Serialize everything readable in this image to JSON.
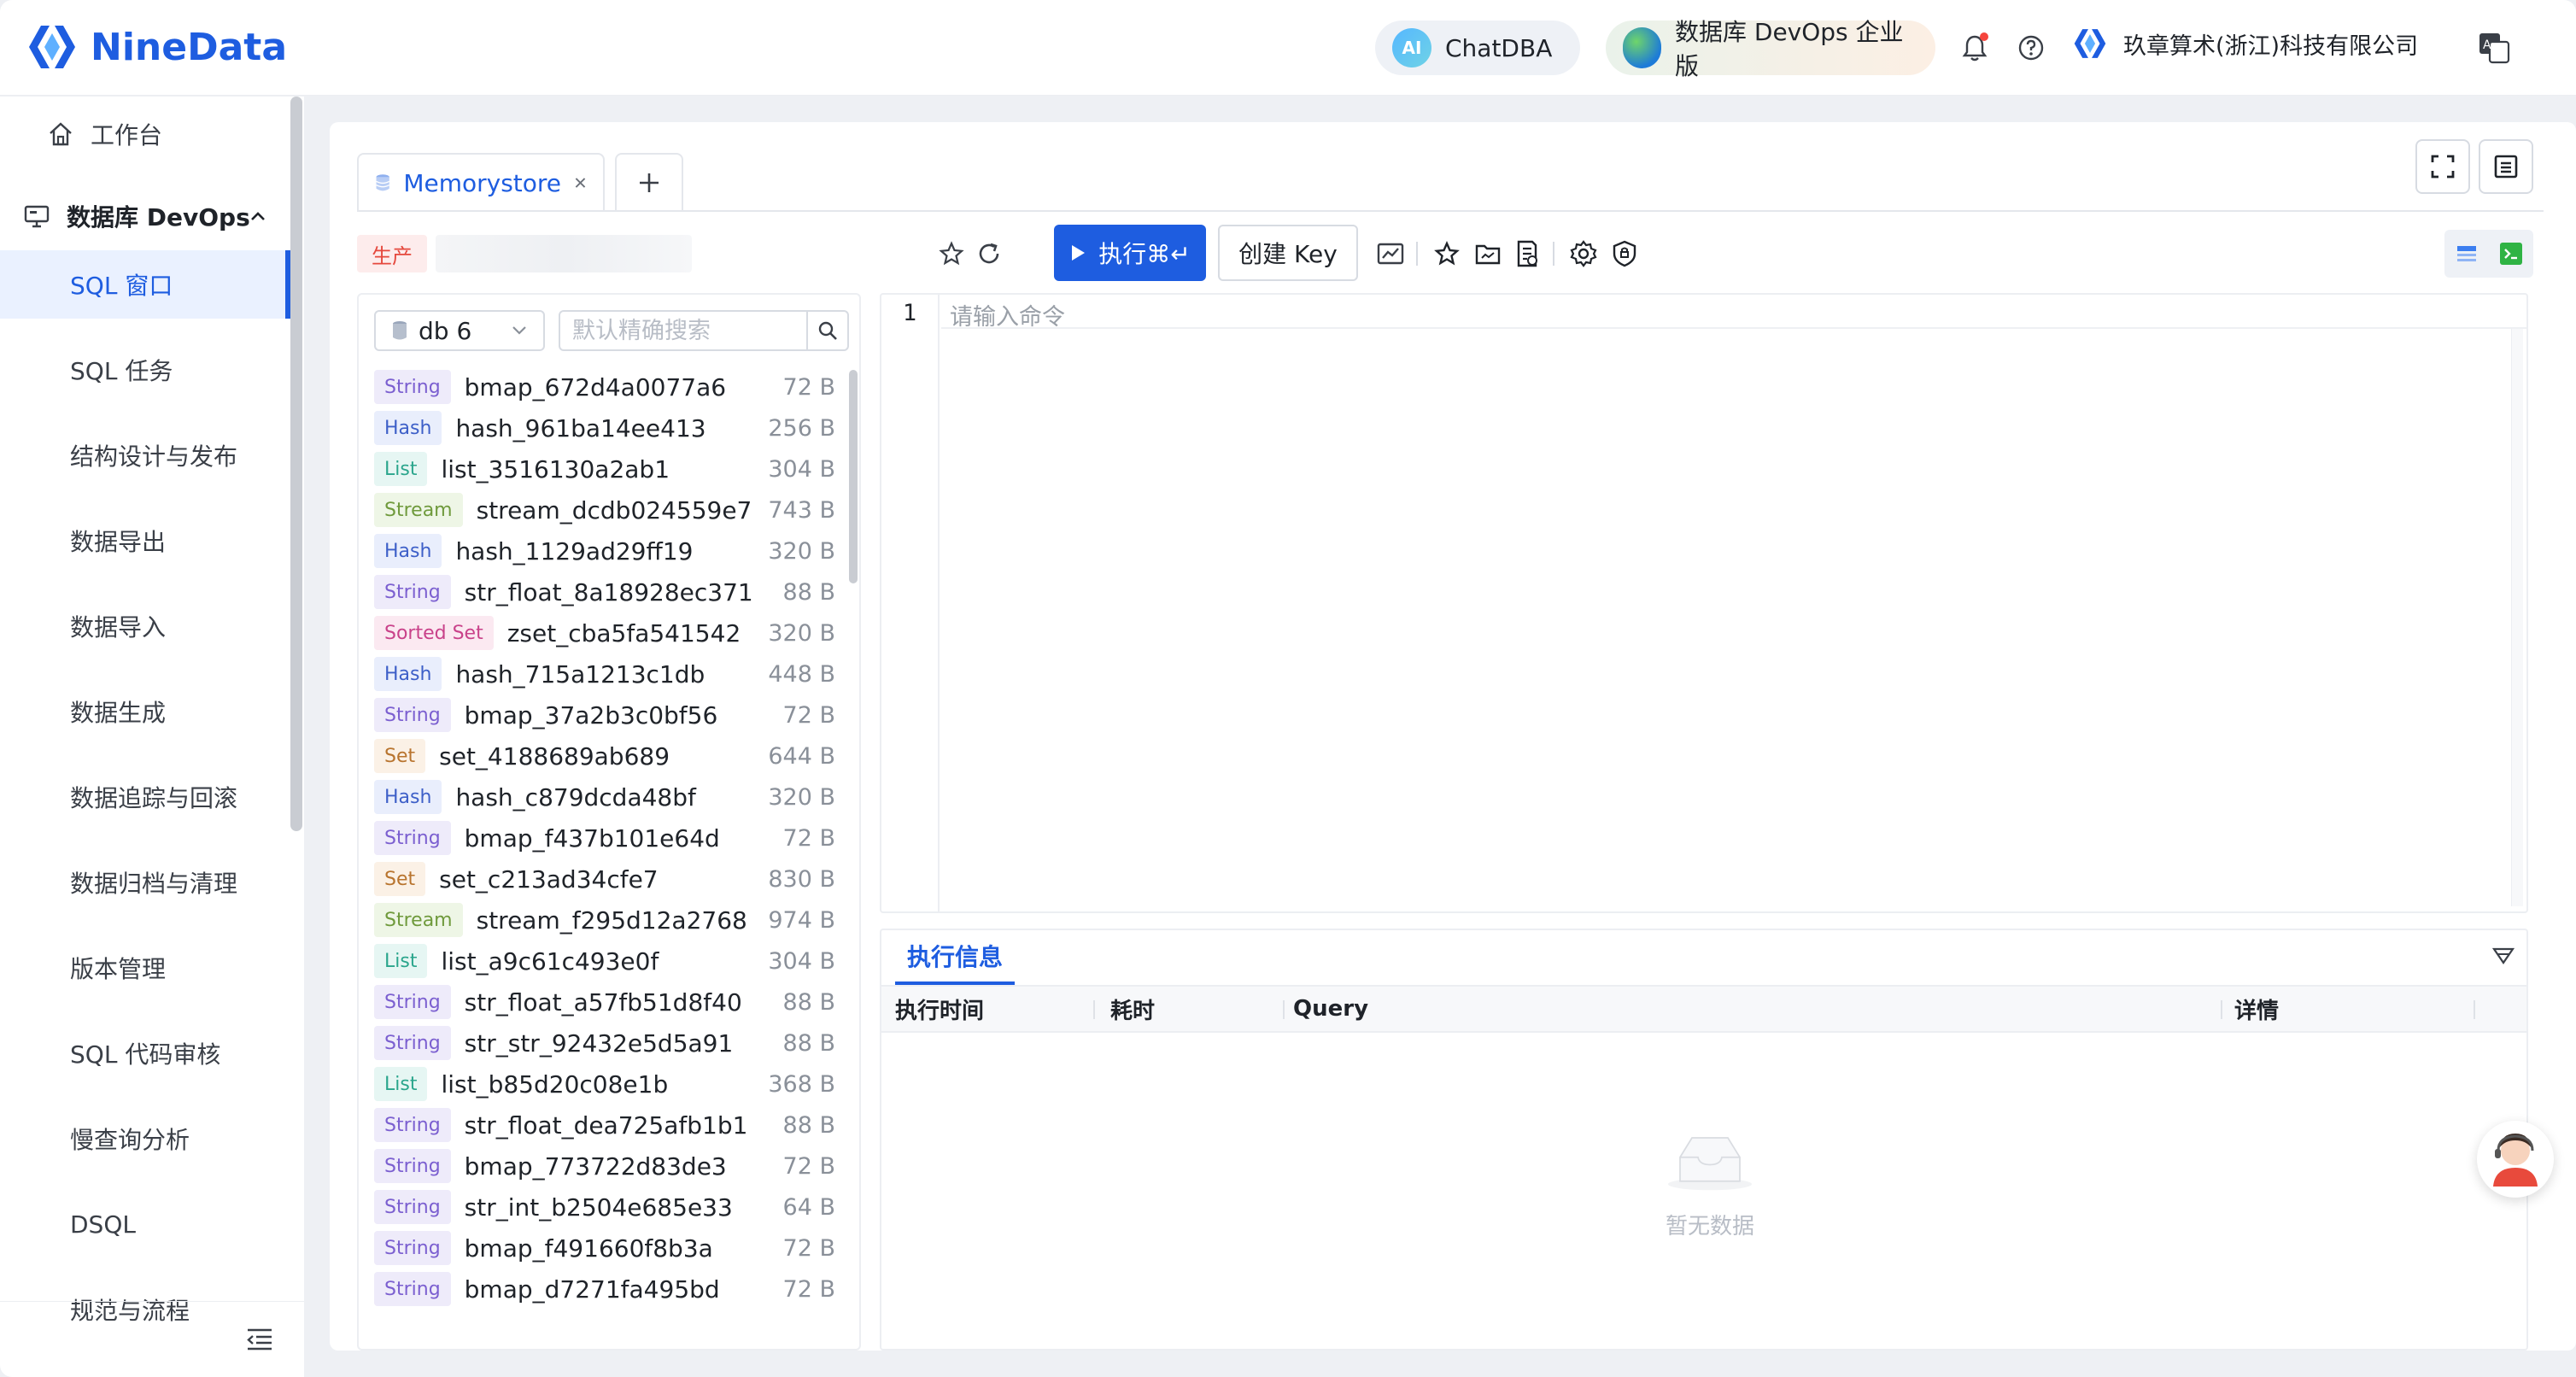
{
  "header": {
    "brand": "NineData",
    "chatdba": {
      "badge": "AI",
      "label": "ChatDBA"
    },
    "edition": "数据库 DevOps 企业版",
    "company": "玖章算术(浙江)科技有限公司"
  },
  "sidebar": {
    "workbench": "工作台",
    "group": "数据库 DevOps",
    "items": [
      {
        "label": "SQL 窗口",
        "active": true
      },
      {
        "label": "SQL 任务"
      },
      {
        "label": "结构设计与发布"
      },
      {
        "label": "数据导出"
      },
      {
        "label": "数据导入"
      },
      {
        "label": "数据生成"
      },
      {
        "label": "数据追踪与回滚"
      },
      {
        "label": "数据归档与清理"
      },
      {
        "label": "版本管理"
      },
      {
        "label": "SQL 代码审核"
      },
      {
        "label": "慢查询分析"
      },
      {
        "label": "DSQL"
      },
      {
        "label": "规范与流程"
      }
    ]
  },
  "tabs": [
    {
      "label": "Memorystore"
    }
  ],
  "toolbar": {
    "env_tag": "生产",
    "execute_label": "执行⌘↵",
    "create_key_label": "创建 Key"
  },
  "key_panel": {
    "db_selected": "db 6",
    "search_placeholder": "默认精确搜索",
    "keys": [
      {
        "type": "String",
        "name": "bmap_672d4a0077a6",
        "size": "72 B"
      },
      {
        "type": "Hash",
        "name": "hash_961ba14ee413",
        "size": "256 B"
      },
      {
        "type": "List",
        "name": "list_3516130a2ab1",
        "size": "304 B"
      },
      {
        "type": "Stream",
        "name": "stream_dcdb024559e7",
        "size": "743 B"
      },
      {
        "type": "Hash",
        "name": "hash_1129ad29ff19",
        "size": "320 B"
      },
      {
        "type": "String",
        "name": "str_float_8a18928ec371",
        "size": "88 B"
      },
      {
        "type": "Sorted Set",
        "name": "zset_cba5fa541542",
        "size": "320 B"
      },
      {
        "type": "Hash",
        "name": "hash_715a1213c1db",
        "size": "448 B"
      },
      {
        "type": "String",
        "name": "bmap_37a2b3c0bf56",
        "size": "72 B"
      },
      {
        "type": "Set",
        "name": "set_4188689ab689",
        "size": "644 B"
      },
      {
        "type": "Hash",
        "name": "hash_c879dcda48bf",
        "size": "320 B"
      },
      {
        "type": "String",
        "name": "bmap_f437b101e64d",
        "size": "72 B"
      },
      {
        "type": "Set",
        "name": "set_c213ad34cfe7",
        "size": "830 B"
      },
      {
        "type": "Stream",
        "name": "stream_f295d12a2768",
        "size": "974 B"
      },
      {
        "type": "List",
        "name": "list_a9c61c493e0f",
        "size": "304 B"
      },
      {
        "type": "String",
        "name": "str_float_a57fb51d8f40",
        "size": "88 B"
      },
      {
        "type": "String",
        "name": "str_str_92432e5d5a91",
        "size": "88 B"
      },
      {
        "type": "List",
        "name": "list_b85d20c08e1b",
        "size": "368 B"
      },
      {
        "type": "String",
        "name": "str_float_dea725afb1b1",
        "size": "88 B"
      },
      {
        "type": "String",
        "name": "bmap_773722d83de3",
        "size": "72 B"
      },
      {
        "type": "String",
        "name": "str_int_b2504e685e33",
        "size": "64 B"
      },
      {
        "type": "String",
        "name": "bmap_f491660f8b3a",
        "size": "72 B"
      },
      {
        "type": "String",
        "name": "bmap_d7271fa495bd",
        "size": "72 B"
      }
    ]
  },
  "editor": {
    "line_number": "1",
    "placeholder": "请输入命令"
  },
  "exec_info": {
    "tab_label": "执行信息",
    "columns": [
      "执行时间",
      "耗时",
      "Query",
      "详情"
    ],
    "empty_text": "暂无数据"
  },
  "colors": {
    "accent": "#1e5de0",
    "String": {
      "bg": "#eeebfa",
      "fg": "#7b5fd0"
    },
    "Hash": {
      "bg": "#e9eefc",
      "fg": "#3d5fc8"
    },
    "List": {
      "bg": "#e6f6f3",
      "fg": "#2aa58c"
    },
    "Stream": {
      "bg": "#eef6e6",
      "fg": "#6f9a3c"
    },
    "Sorted Set": {
      "bg": "#fbe9f1",
      "fg": "#c9428a"
    },
    "Set": {
      "bg": "#fbf1e6",
      "fg": "#b8742e"
    }
  },
  "icons": [
    "home-icon",
    "monitor-icon",
    "chevron-up-icon",
    "bell-icon",
    "help-icon",
    "translate-icon",
    "database-icon",
    "close-icon",
    "plus-icon",
    "fullscreen-icon",
    "layout-icon",
    "star-icon",
    "refresh-icon",
    "play-icon",
    "chart-icon",
    "folder-icon",
    "document-icon",
    "gear-icon",
    "shield-icon",
    "search-icon",
    "chevron-down-icon",
    "filter-icon",
    "empty-box-icon",
    "support-avatar-icon",
    "menu-collapse-icon"
  ]
}
